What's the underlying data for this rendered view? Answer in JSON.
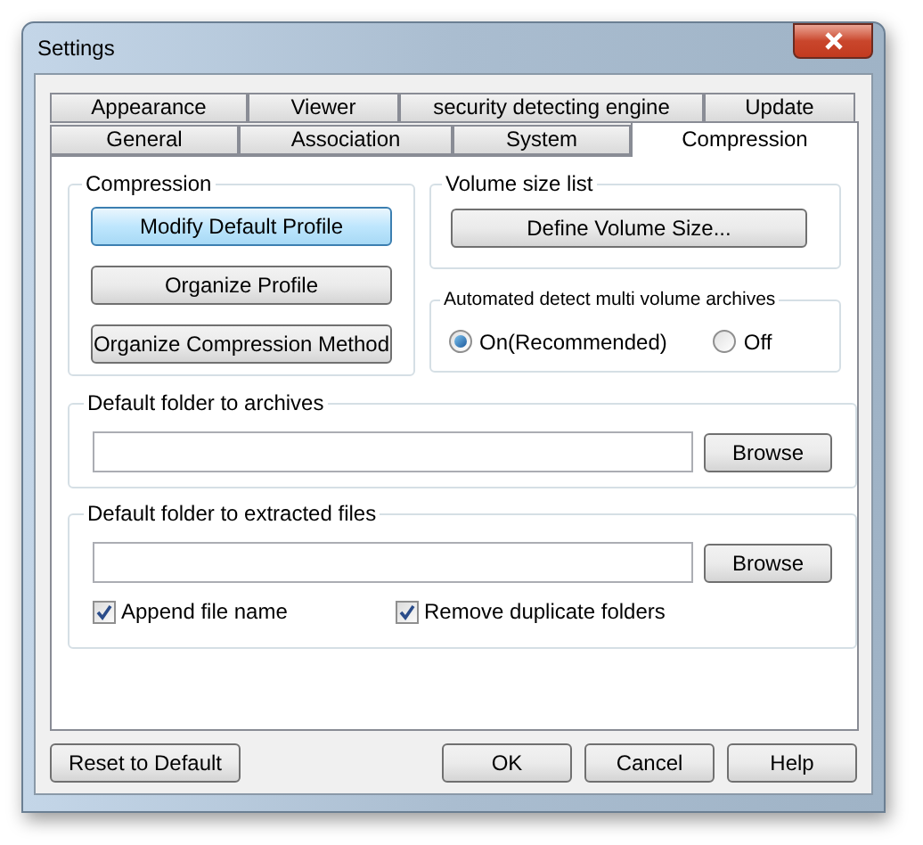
{
  "window": {
    "title": "Settings"
  },
  "tab_rows": [
    [
      {
        "label": "Appearance",
        "selected": false
      },
      {
        "label": "Viewer",
        "selected": false
      },
      {
        "label": "security detecting engine",
        "selected": false
      },
      {
        "label": "Update",
        "selected": false
      }
    ],
    [
      {
        "label": "General",
        "selected": false
      },
      {
        "label": "Association",
        "selected": false
      },
      {
        "label": "System",
        "selected": false
      },
      {
        "label": "Compression",
        "selected": true
      }
    ]
  ],
  "compression": {
    "title": "Compression",
    "buttons": [
      {
        "label": "Modify Default Profile",
        "focused": true
      },
      {
        "label": "Organize Profile",
        "focused": false
      },
      {
        "label": "Organize Compression Method",
        "focused": false
      }
    ]
  },
  "volume_size_list": {
    "title": "Volume size list",
    "button": "Define Volume Size..."
  },
  "multi_volume": {
    "title": "Automated detect multi volume archives",
    "options": [
      {
        "label": "On(Recommended)",
        "selected": true
      },
      {
        "label": "Off",
        "selected": false
      }
    ]
  },
  "archives_folder": {
    "title": "Default folder to archives",
    "button": "Browse"
  },
  "extracted_folder": {
    "title": "Default folder to extracted files",
    "button": "Browse",
    "checkboxes": [
      {
        "label": "Append file name",
        "checked": true
      },
      {
        "label": "Remove duplicate folders",
        "checked": true
      }
    ]
  },
  "footer": {
    "reset": "Reset to Default",
    "buttons": [
      "OK",
      "Cancel",
      "Help"
    ]
  }
}
